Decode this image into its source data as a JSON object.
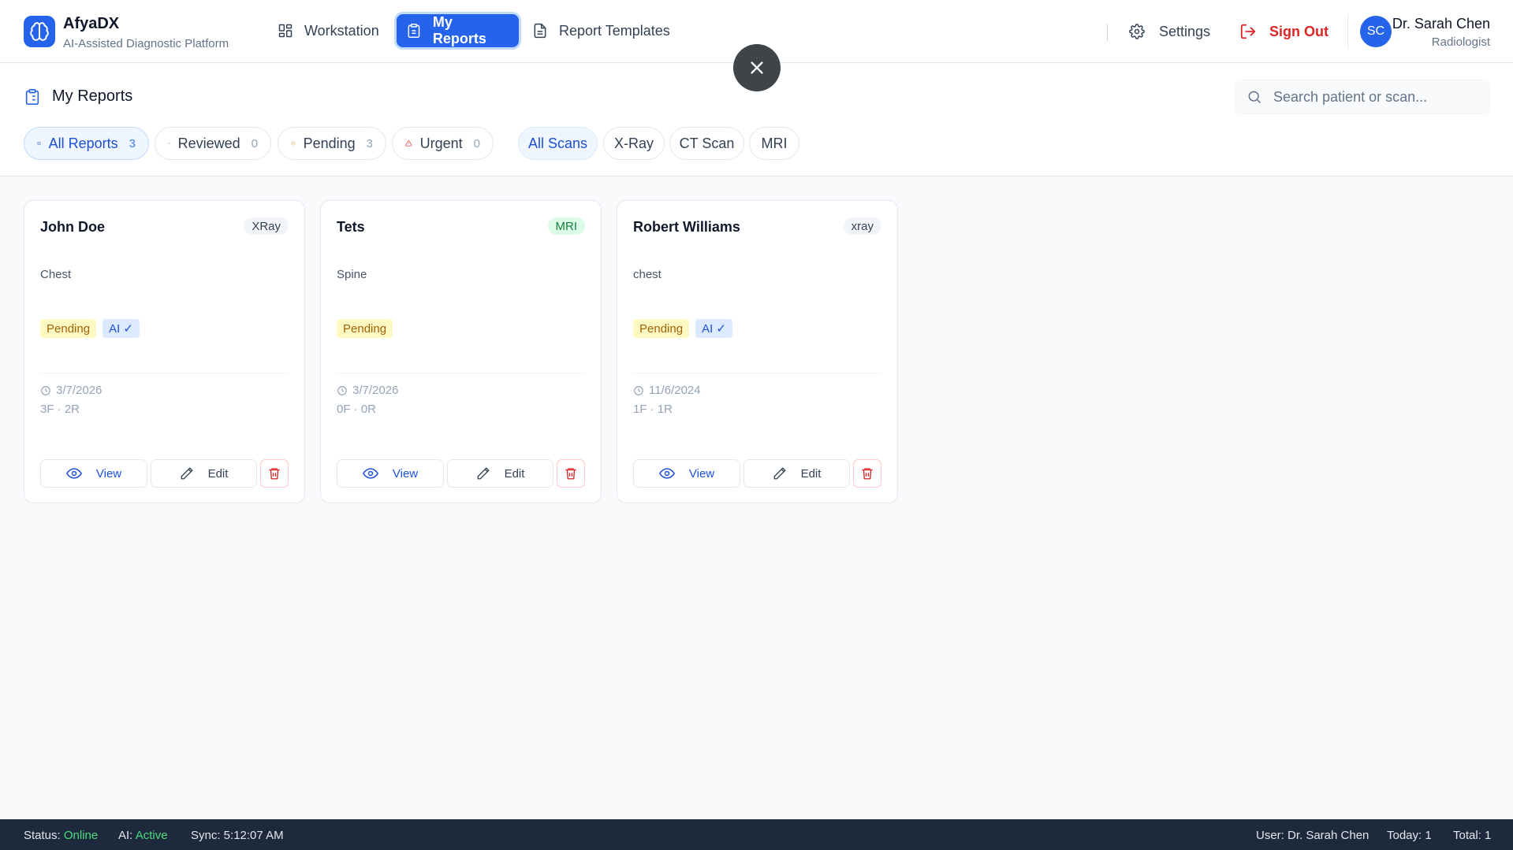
{
  "app": {
    "name": "AfyaDX",
    "tagline": "AI-Assisted Diagnostic Platform"
  },
  "nav": {
    "workstation": "Workstation",
    "my_reports": "My Reports",
    "report_templates": "Report Templates",
    "settings": "Settings",
    "sign_out": "Sign Out"
  },
  "user": {
    "initials": "SC",
    "name": "Dr. Sarah Chen",
    "role": "Radiologist"
  },
  "page": {
    "title": "My Reports",
    "search_placeholder": "Search patient or scan..."
  },
  "status_filters": [
    {
      "label": "All Reports",
      "count": "3",
      "icon": "book-open-icon",
      "active": true
    },
    {
      "label": "Reviewed",
      "count": "0",
      "icon": "check-circle-icon"
    },
    {
      "label": "Pending",
      "count": "3",
      "icon": "clock-icon"
    },
    {
      "label": "Urgent",
      "count": "0",
      "icon": "alert-triangle-icon"
    }
  ],
  "scan_filters": [
    {
      "label": "All Scans",
      "active": true
    },
    {
      "label": "X-Ray"
    },
    {
      "label": "CT Scan"
    },
    {
      "label": "MRI"
    }
  ],
  "reports": [
    {
      "patient": "John Doe",
      "scan_type": "XRay",
      "body_part": "Chest",
      "status": "Pending",
      "ai_tag": "AI ✓",
      "date": "3/7/2026",
      "counts": "3F · 2R",
      "view_label": "View",
      "edit_label": "Edit"
    },
    {
      "patient": "Tets",
      "scan_type": "MRI",
      "body_part": "Spine",
      "status": "Pending",
      "ai_tag": "",
      "date": "3/7/2026",
      "counts": "0F · 0R",
      "view_label": "View",
      "edit_label": "Edit"
    },
    {
      "patient": "Robert Williams",
      "scan_type": "xray",
      "body_part": "chest",
      "status": "Pending",
      "ai_tag": "AI ✓",
      "date": "11/6/2024",
      "counts": "1F · 1R",
      "view_label": "View",
      "edit_label": "Edit"
    }
  ],
  "statusbar": {
    "status_label": "Status:",
    "status_value": "Online",
    "ai_label": "AI:",
    "ai_value": "Active",
    "sync": "Sync: 5:12:07 AM",
    "user": "User: Dr. Sarah Chen",
    "today": "Today: 1",
    "total": "Total: 1"
  },
  "colors": {
    "primary": "#2563eb",
    "danger": "#dc2626",
    "pending_bg": "#fef9c3",
    "statusbar_bg": "#1e293b",
    "online": "#4ade80"
  }
}
